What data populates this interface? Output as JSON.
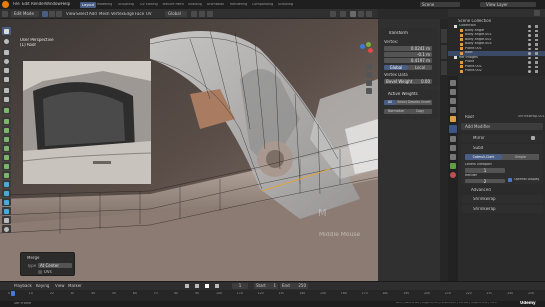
{
  "topbar": {
    "menus": [
      "File",
      "Edit",
      "Render",
      "Window",
      "Help"
    ],
    "workspaces": [
      "Layout",
      "Modeling",
      "Sculpting",
      "UV Editing",
      "Texture Paint",
      "Shading",
      "Animation",
      "Rendering",
      "Compositing",
      "Scripting"
    ],
    "active_workspace": "Layout",
    "scene": "Scene",
    "view_layer": "View Layer"
  },
  "header": {
    "mode": "Edit Mode",
    "menus": [
      "View",
      "Select",
      "Add",
      "Mesh",
      "Vertex",
      "Edge",
      "Face",
      "UV"
    ],
    "orientation": "Global"
  },
  "viewport": {
    "view_name": "User Perspective",
    "object_name": "(1) Roof",
    "watermark_line1": "Middle Mouse"
  },
  "npanel": {
    "transform_title": "Transform",
    "vertex_label": "Vertex:",
    "x": "0.0241 m",
    "y": "-0.1 m",
    "z": "0.4197 m",
    "global": "Global",
    "local": "Local",
    "vertex_data_label": "Vertex Data",
    "bevel_weight_label": "Bevel Weight",
    "bevel_weight_value": "0.00",
    "active_weights_label": "Active Weights",
    "tabs": [
      "All",
      "Select",
      "Deselect",
      "Invert"
    ],
    "normalize": "Normalize",
    "copy": "Copy"
  },
  "outliner": {
    "title": "Scene Collection",
    "items": [
      {
        "label": "Collection",
        "indent": 0
      },
      {
        "label": "Body angle",
        "indent": 1
      },
      {
        "label": "Body angle.001",
        "indent": 1
      },
      {
        "label": "Body angle.002",
        "indent": 1
      },
      {
        "label": "Body angle.003",
        "indent": 1
      },
      {
        "label": "Plane.001",
        "indent": 1
      },
      {
        "label": "Roof",
        "indent": 1
      },
      {
        "label": "Ref images",
        "indent": 0
      },
      {
        "label": "Plane",
        "indent": 1
      },
      {
        "label": "Plane.001",
        "indent": 1
      },
      {
        "label": "Plane.002",
        "indent": 1
      }
    ],
    "selected_index": 6
  },
  "properties": {
    "object_name": "Roof",
    "modifier_name": "Shrinkwrap.001",
    "add_modifier": "Add Modifier",
    "mirror": "Mirror",
    "subdivision": "Subd",
    "tabs": [
      "Catmull-Clark",
      "Simple"
    ],
    "levels_viewport_label": "Levels Viewport",
    "levels_viewport_value": "1",
    "render_label": "Render",
    "render_value": "2",
    "optimal_display": "Optimal Display",
    "advanced": "Advanced",
    "shrinkwrap": "Shrinkwrap",
    "shrinkwrap2": "Shrinkwrap"
  },
  "merge_panel": {
    "title": "Merge",
    "type_label": "Type",
    "type_value": "At Center",
    "uvs": "UVs"
  },
  "timeline": {
    "menus": [
      "Playback",
      "Keying",
      "View",
      "Marker"
    ],
    "start_label": "Start",
    "start": "1",
    "end_label": "End",
    "end": "250",
    "ticks": [
      "0",
      "10",
      "20",
      "30",
      "40",
      "50",
      "60",
      "70",
      "80",
      "90",
      "100",
      "110",
      "120",
      "130",
      "140",
      "150",
      "160",
      "170",
      "180",
      "190",
      "200",
      "210",
      "220",
      "230",
      "240",
      "250"
    ]
  },
  "statusbar": {
    "left": "Set Frame",
    "right": "Roof | Verts 0/198 | Edges 0/378 | Faces 0/181 | Tris 362 | Objects 1/11 | 3.0.0",
    "logo": "Udemy"
  },
  "colors": {
    "accent": "#4a5d84",
    "active_tab": "#3b5686",
    "selection": "#f0a020",
    "wire": "#1a1a1a"
  }
}
